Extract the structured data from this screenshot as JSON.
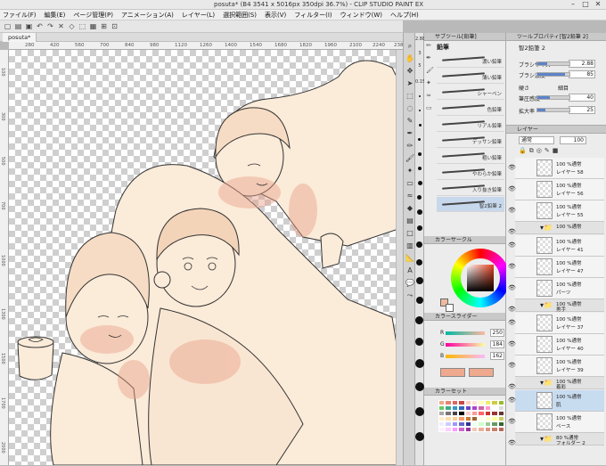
{
  "window": {
    "title": "posuta* (B4 3541 x 5016px 350dpi 36.7%)  - CLIP STUDIO PAINT EX",
    "minimize": "–",
    "maximize": "□",
    "close": "✕"
  },
  "menu": [
    "ファイル(F)",
    "編集(E)",
    "ページ管理(P)",
    "アニメーション(A)",
    "レイヤー(L)",
    "選択範囲(S)",
    "表示(V)",
    "フィルター(I)",
    "ウィンドウ(W)",
    "ヘルプ(H)"
  ],
  "document_tab": "posuta*",
  "ruler_h": [
    "280",
    "420",
    "560",
    "700",
    "840",
    "980",
    "1120",
    "1260",
    "1400",
    "1540",
    "1680",
    "1820",
    "1960",
    "2100",
    "2240",
    "2380"
  ],
  "ruler_v": [
    "100",
    "300",
    "500",
    "700",
    "1000",
    "1300",
    "1500",
    "1700",
    "2000"
  ],
  "brush_sizes": [
    "2.88",
    "3",
    "5",
    "0.15",
    "4",
    "5",
    "7",
    "10",
    "12",
    "15",
    "20",
    "25",
    "30",
    "40",
    "50",
    "60",
    "70",
    "80",
    "100",
    "120",
    "150",
    "170",
    "200",
    "250",
    "300"
  ],
  "subtool": {
    "header": "サブツール[鉛筆]",
    "group": "鉛筆",
    "items": [
      "濃い鉛筆",
      "薄い鉛筆",
      "シャーペン",
      "色鉛筆",
      "リアル鉛筆",
      "デッサン鉛筆",
      "粗い鉛筆",
      "やわらか鉛筆",
      "入り抜き鉛筆",
      "智2鉛筆 2"
    ]
  },
  "color_circle": {
    "header": "カラーサークル",
    "main_color": "#efbaa0",
    "sub_color": "#ffffff"
  },
  "color_slider": {
    "header": "カラースライダー",
    "rows": [
      {
        "channel": "R",
        "value": "250"
      },
      {
        "channel": "G",
        "value": "184"
      },
      {
        "channel": "B",
        "value": "162"
      }
    ]
  },
  "color_set": {
    "header": "カラーセット"
  },
  "tool_property": {
    "header": "ツールプロパティ[智2鉛筆 2]",
    "title": "智2鉛筆 2",
    "rows": [
      {
        "label": "ブラシサイズ",
        "value": "2.88",
        "fill": 0.3
      },
      {
        "label": "ブラシ濃度",
        "value": "85",
        "fill": 0.85
      },
      {
        "label": "硬さ",
        "value": "",
        "fill": 0.5
      },
      {
        "label": "筆圧感度",
        "value": "40",
        "fill": 0.4
      },
      {
        "label": "拡大率",
        "value": "25",
        "fill": 0.25
      }
    ],
    "aux": "細目"
  },
  "layers_panel": {
    "header": "レイヤー",
    "blend": "通常",
    "opacity": "100",
    "layers": [
      {
        "type": "layer",
        "l1": "100 %通常",
        "l2": "レイヤー 58"
      },
      {
        "type": "layer",
        "l1": "100 %通常",
        "l2": "レイヤー 56"
      },
      {
        "type": "layer",
        "l1": "100 %通常",
        "l2": "レイヤー 55"
      },
      {
        "type": "folder",
        "l1": "100 %通常",
        "l2": ""
      },
      {
        "type": "layer",
        "l1": "100 %通常",
        "l2": "レイヤー 41"
      },
      {
        "type": "layer",
        "l1": "100 %通常",
        "l2": "レイヤー 47"
      },
      {
        "type": "layer",
        "l1": "100 %通常",
        "l2": "パーツ"
      },
      {
        "type": "folder",
        "l1": "100 %通常",
        "l2": "男手"
      },
      {
        "type": "layer",
        "l1": "100 %通常",
        "l2": "レイヤー 37"
      },
      {
        "type": "layer",
        "l1": "100 %通常",
        "l2": "レイヤー 40"
      },
      {
        "type": "layer",
        "l1": "100 %通常",
        "l2": "レイヤー 39"
      },
      {
        "type": "folder",
        "l1": "100 %通常",
        "l2": "着彩"
      },
      {
        "type": "layer",
        "l1": "100 %通常",
        "l2": "肌",
        "selected": true
      },
      {
        "type": "layer",
        "l1": "100 %通常",
        "l2": "ベース"
      },
      {
        "type": "folder",
        "l1": "80 %通常",
        "l2": "フォルダー 2"
      }
    ]
  }
}
